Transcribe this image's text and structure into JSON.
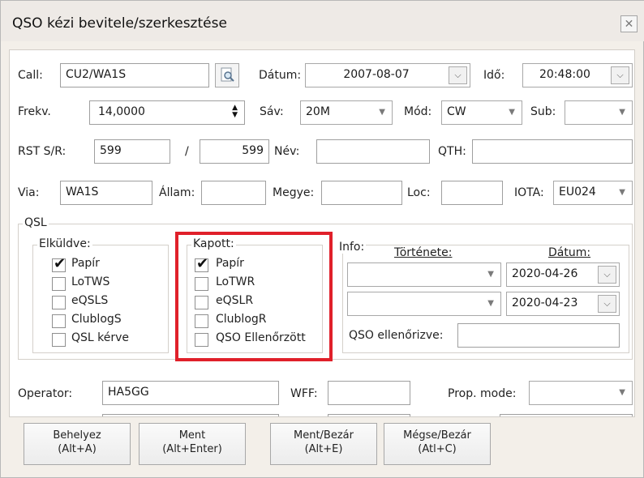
{
  "window": {
    "title": "QSO kézi bevitele/szerkesztése",
    "close_glyph": "✕"
  },
  "row1": {
    "call_label": "Call:",
    "call_value": "CU2/WA1S",
    "date_label": "Dátum:",
    "date_value": "2007-08-07",
    "time_label": "Idő:",
    "time_value": "20:48:00"
  },
  "row2": {
    "freq_label": "Frekv.",
    "freq_value": "14,0000",
    "band_label": "Sáv:",
    "band_value": "20M",
    "mode_label": "Mód:",
    "mode_value": "CW",
    "sub_label": "Sub:",
    "sub_value": ""
  },
  "row3": {
    "rst_label": "RST S/R:",
    "rst_sent": "599",
    "slash": "/",
    "rst_rcvd": "599",
    "name_label": "Név:",
    "name_value": "",
    "qth_label": "QTH:",
    "qth_value": ""
  },
  "row4": {
    "via_label": "Via:",
    "via_value": "WA1S",
    "state_label": "Állam:",
    "state_value": "",
    "county_label": "Megye:",
    "county_value": "",
    "loc_label": "Loc:",
    "loc_value": "",
    "iota_label": "IOTA:",
    "iota_value": "EU024"
  },
  "qsl": {
    "title": "QSL",
    "sent": {
      "title": "Elküldve:",
      "items": [
        {
          "label": "Papír",
          "checked": true
        },
        {
          "label": "LoTWS",
          "checked": false
        },
        {
          "label": "eQSLS",
          "checked": false
        },
        {
          "label": "ClublogS",
          "checked": false
        },
        {
          "label": "QSL kérve",
          "checked": false
        }
      ]
    },
    "received": {
      "title": "Kapott:",
      "items": [
        {
          "label": "Papír",
          "checked": true
        },
        {
          "label": "LoTWR",
          "checked": false
        },
        {
          "label": "eQSLR",
          "checked": false
        },
        {
          "label": "ClublogR",
          "checked": false
        },
        {
          "label": "QSO Ellenőrzött",
          "checked": false
        }
      ]
    },
    "info": {
      "title": "Info:",
      "history_label": "Története:",
      "date_label": "Dátum:",
      "history1": "",
      "date1": "2020-04-26",
      "history2": "",
      "date2": "2020-04-23",
      "verified_label": "QSO ellenőrizve:",
      "verified_value": ""
    },
    "check_glyph": "✔",
    "highlight_color": "#e0202a"
  },
  "row5": {
    "operator_label": "Operator:",
    "operator_value": "HA5GG",
    "wff_label": "WFF:",
    "wff_value": "",
    "prop_label": "Prop. mode:",
    "prop_value": ""
  },
  "buttons": {
    "insert": {
      "line1": "Behelyez",
      "line2": "(Alt+A)"
    },
    "save": {
      "line1": "Ment",
      "line2": "(Alt+Enter)"
    },
    "save_close": {
      "line1": "Ment/Bezár",
      "line2": "(Alt+E)"
    },
    "cancel_close": {
      "line1": "Mégse/Bezár",
      "line2": "(Atl+C)"
    }
  },
  "glyphs": {
    "dropdown": "▼",
    "chevron": "⌵",
    "spin_up": "▲",
    "spin_down": "▼"
  }
}
